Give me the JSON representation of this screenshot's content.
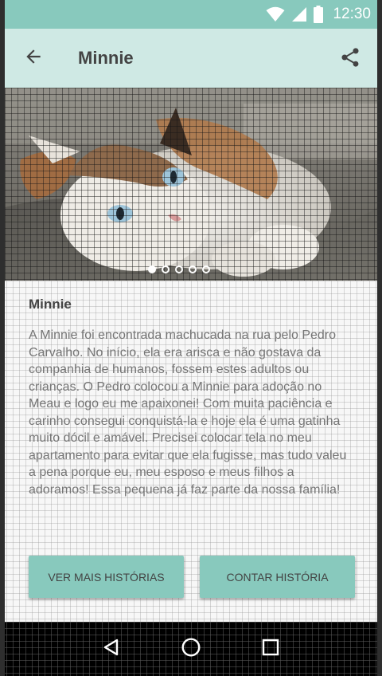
{
  "status_bar": {
    "time": "12:30",
    "icons": [
      "wifi-icon",
      "signal-icon",
      "battery-icon"
    ],
    "color": "#88c9bd"
  },
  "toolbar": {
    "title": "Minnie",
    "back_icon": "arrow-back-icon",
    "share_icon": "share-icon",
    "color": "#cfe9e4"
  },
  "gallery": {
    "image_subject": "cat photo",
    "page_count": 5,
    "active_page": 1
  },
  "story": {
    "name": "Minnie",
    "text": "A Minnie foi encontrada machucada na rua pelo Pedro Carvalho. No início, ela era arisca e não gostava da companhia de humanos, fossem estes adultos ou crianças. O Pedro colocou a Minnie para adoção no Meau e logo eu me apaixonei! Com muita paciência e carinho consegui conquistá-la e hoje ela é uma gatinha muito dócil e amável. Precisei colocar tela no meu apartamento para evitar que ela fugisse, mas tudo valeu a pena porque eu, meu esposo e meus filhos a adoramos! Essa pequena já faz parte da nossa família!"
  },
  "actions": {
    "more_stories_label": "VER MAIS HISTÓRIAS",
    "tell_story_label": "CONTAR HISTÓRIA",
    "accent": "#88c9bd"
  },
  "nav_bar": {
    "icons": [
      "back-triangle-icon",
      "home-circle-icon",
      "recents-square-icon"
    ]
  }
}
